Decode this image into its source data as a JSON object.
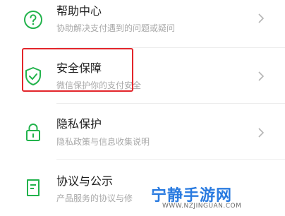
{
  "menu": {
    "items": [
      {
        "title": "帮助中心",
        "subtitle": "协助解决支付遇到的问题或疑问",
        "icon": "help-circle-icon"
      },
      {
        "title": "安全保障",
        "subtitle": "微信保护你的支付安全",
        "icon": "shield-check-icon"
      },
      {
        "title": "隐私保护",
        "subtitle": "隐私政策与信息收集说明",
        "icon": "lock-icon"
      },
      {
        "title": "协议与公示",
        "subtitle": "产品服务的协议与修",
        "icon": "document-icon"
      }
    ]
  },
  "watermark": {
    "name": "宁静手游网",
    "url": "WWW.NZJINGUAN.COM"
  },
  "colors": {
    "accent": "#22b34c",
    "highlight": "#e3262b",
    "watermark": "#2a7be0"
  }
}
